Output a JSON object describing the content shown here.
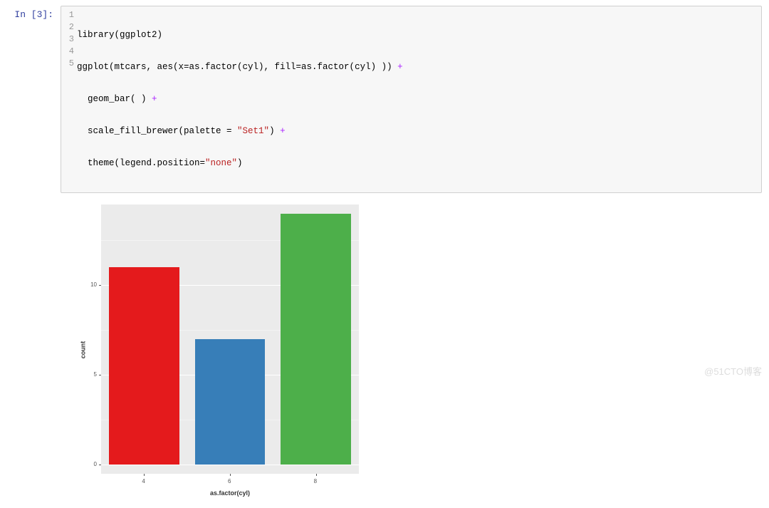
{
  "cell": {
    "prompt": "In  [3]:",
    "line_numbers": [
      "1",
      "2",
      "3",
      "4",
      "5"
    ],
    "code": {
      "l1a": "library(ggplot2)",
      "l2a": "ggplot(mtcars, aes(x=as.factor(cyl), fill=as.factor(cyl) )) ",
      "l2b": "+",
      "l3a": "  geom_bar( ) ",
      "l3b": "+",
      "l4a": "  scale_fill_brewer(palette = ",
      "l4b": "\"Set1\"",
      "l4c": ") ",
      "l4d": "+",
      "l5a": "  theme(legend.position=",
      "l5b": "\"none\"",
      "l5c": ")"
    }
  },
  "chart_data": {
    "type": "bar",
    "categories": [
      "4",
      "6",
      "8"
    ],
    "values": [
      11,
      7,
      14
    ],
    "colors": [
      "#E41A1C",
      "#377EB8",
      "#4DAF4A"
    ],
    "xlabel": "as.factor(cyl)",
    "ylabel": "count",
    "ylim": [
      0,
      14
    ],
    "y_breaks": [
      0,
      5,
      10
    ],
    "y_minor": [
      2.5,
      7.5,
      12.5
    ]
  },
  "watermark": "@51CTO博客"
}
